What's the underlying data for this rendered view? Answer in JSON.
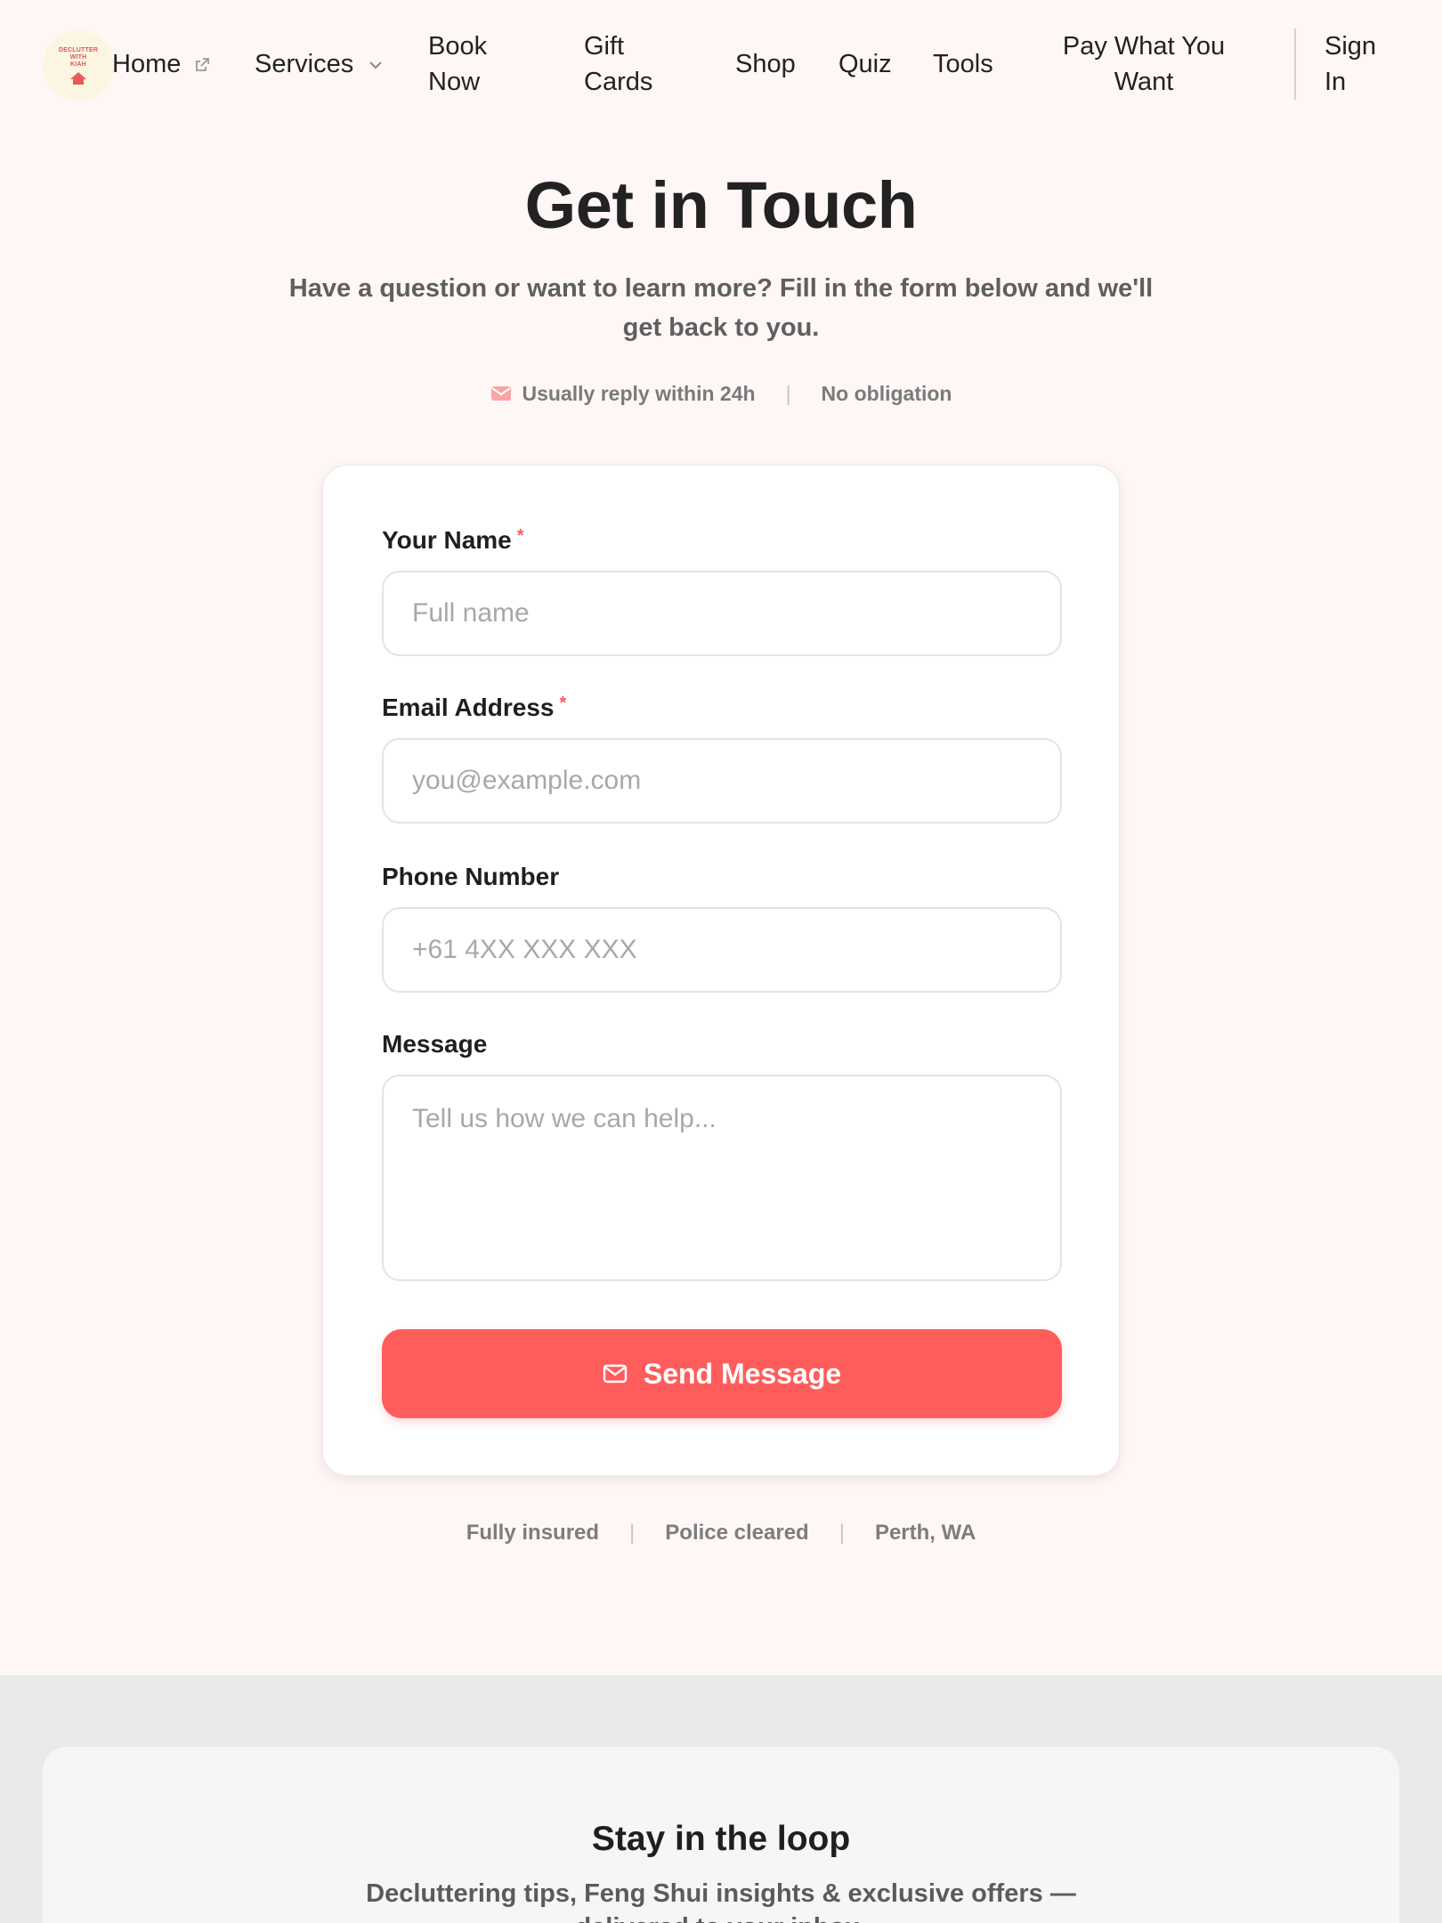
{
  "header": {
    "logo_text": [
      "DECLUTTER",
      "WITH",
      "KIAH"
    ],
    "nav": [
      {
        "label": "Home"
      },
      {
        "label": "Services"
      },
      {
        "label": "Book Now"
      },
      {
        "label": "Gift Cards"
      },
      {
        "label": "Shop"
      },
      {
        "label": "Quiz"
      },
      {
        "label": "Tools"
      },
      {
        "label": "Pay What You Want"
      },
      {
        "label": "Sign In"
      }
    ]
  },
  "hero": {
    "title": "Get in Touch",
    "subtitle": "Have a question or want to learn more? Fill in the form below and we'll get back to you.",
    "badge_reply": "Usually reply within 24h",
    "badge_obligation": "No obligation"
  },
  "form": {
    "name_label": "Your Name",
    "name_placeholder": "Full name",
    "email_label": "Email Address",
    "email_placeholder": "you@example.com",
    "phone_label": "Phone Number",
    "phone_placeholder": "+61 4XX XXX XXX",
    "message_label": "Message",
    "message_placeholder": "Tell us how we can help...",
    "required_mark": "*",
    "submit_label": "Send Message"
  },
  "trust": [
    "Fully insured",
    "Police cleared",
    "Perth, WA"
  ],
  "separator": "|",
  "newsletter": {
    "title": "Stay in the loop",
    "description": "Decluttering tips, Feng Shui insights & exclusive offers — delivered to your inbox."
  },
  "colors": {
    "accent": "#ff5c5c",
    "page_bg": "#fff7f6",
    "footer_bg": "#e9eaeb"
  }
}
